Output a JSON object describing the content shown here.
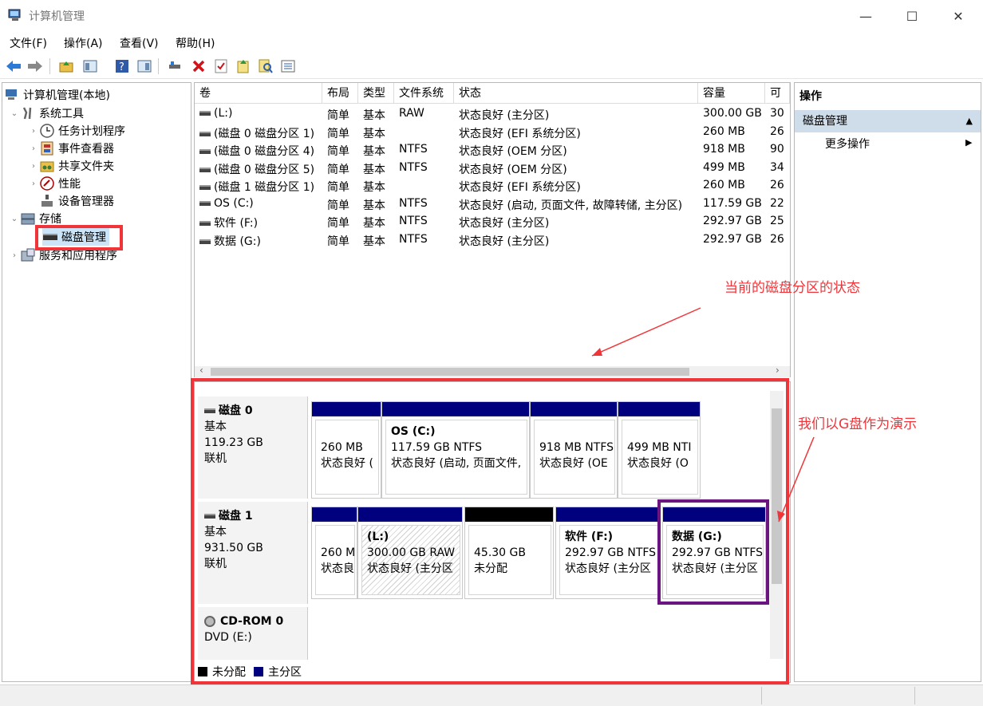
{
  "window": {
    "title": "计算机管理",
    "minimize_glyph": "—",
    "maximize_glyph": "☐",
    "close_glyph": "✕"
  },
  "menu": [
    "文件(F)",
    "操作(A)",
    "查看(V)",
    "帮助(H)"
  ],
  "toolbar_icons": [
    "back-arrow-icon",
    "forward-arrow-icon",
    "up-folder-icon",
    "show-hide-tree-icon",
    "help-icon",
    "properties-view-icon",
    "connect-icon",
    "delete-icon",
    "checklist-icon",
    "export-icon",
    "search-icon",
    "details-icon"
  ],
  "tree": {
    "root": "计算机管理(本地)",
    "system_tools": "系统工具",
    "task_scheduler": "任务计划程序",
    "event_viewer": "事件查看器",
    "shared_folders": "共享文件夹",
    "performance": "性能",
    "device_manager": "设备管理器",
    "storage": "存储",
    "disk_management": "磁盘管理",
    "services_apps": "服务和应用程序"
  },
  "volume_table": {
    "columns": [
      "卷",
      "布局",
      "类型",
      "文件系统",
      "状态",
      "容量",
      "可"
    ],
    "rows": [
      {
        "vol": "(L:)",
        "layout": "简单",
        "type": "基本",
        "fs": "RAW",
        "status": "状态良好 (主分区)",
        "capacity": "300.00 GB",
        "free": "30"
      },
      {
        "vol": "(磁盘 0 磁盘分区 1)",
        "layout": "简单",
        "type": "基本",
        "fs": "",
        "status": "状态良好 (EFI 系统分区)",
        "capacity": "260 MB",
        "free": "26"
      },
      {
        "vol": "(磁盘 0 磁盘分区 4)",
        "layout": "简单",
        "type": "基本",
        "fs": "NTFS",
        "status": "状态良好 (OEM 分区)",
        "capacity": "918 MB",
        "free": "90"
      },
      {
        "vol": "(磁盘 0 磁盘分区 5)",
        "layout": "简单",
        "type": "基本",
        "fs": "NTFS",
        "status": "状态良好 (OEM 分区)",
        "capacity": "499 MB",
        "free": "34"
      },
      {
        "vol": "(磁盘 1 磁盘分区 1)",
        "layout": "简单",
        "type": "基本",
        "fs": "",
        "status": "状态良好 (EFI 系统分区)",
        "capacity": "260 MB",
        "free": "26"
      },
      {
        "vol": "OS (C:)",
        "layout": "简单",
        "type": "基本",
        "fs": "NTFS",
        "status": "状态良好 (启动, 页面文件, 故障转储, 主分区)",
        "capacity": "117.59 GB",
        "free": "22"
      },
      {
        "vol": "软件 (F:)",
        "layout": "简单",
        "type": "基本",
        "fs": "NTFS",
        "status": "状态良好 (主分区)",
        "capacity": "292.97 GB",
        "free": "25"
      },
      {
        "vol": "数据 (G:)",
        "layout": "简单",
        "type": "基本",
        "fs": "NTFS",
        "status": "状态良好 (主分区)",
        "capacity": "292.97 GB",
        "free": "26"
      }
    ]
  },
  "disks": {
    "disk0": {
      "name": "磁盘 0",
      "type": "基本",
      "size": "119.23 GB",
      "state": "联机",
      "parts": [
        {
          "name": "",
          "l1": "260 MB",
          "l2": "状态良好 ("
        },
        {
          "name": "OS  (C:)",
          "l1": "117.59 GB NTFS",
          "l2": "状态良好 (启动, 页面文件,"
        },
        {
          "name": "",
          "l1": "918 MB NTFS",
          "l2": "状态良好 (OE"
        },
        {
          "name": "",
          "l1": "499 MB NTI",
          "l2": "状态良好 (O"
        }
      ]
    },
    "disk1": {
      "name": "磁盘 1",
      "type": "基本",
      "size": "931.50 GB",
      "state": "联机",
      "parts": [
        {
          "name": "",
          "l1": "260 M",
          "l2": "状态良"
        },
        {
          "name": "(L:)",
          "l1": "300.00 GB RAW",
          "l2": "状态良好 (主分区"
        },
        {
          "name": "",
          "l1": "45.30 GB",
          "l2": "未分配"
        },
        {
          "name": "软件  (F:)",
          "l1": "292.97 GB NTFS",
          "l2": "状态良好 (主分区"
        },
        {
          "name": "数据  (G:)",
          "l1": "292.97 GB NTFS",
          "l2": "状态良好 (主分区"
        }
      ]
    },
    "cdrom": {
      "name": "CD-ROM 0",
      "type": "DVD (E:)"
    }
  },
  "legend": {
    "unallocated": "未分配",
    "primary": "主分区"
  },
  "actions": {
    "header": "操作",
    "section": "磁盘管理",
    "more": "更多操作"
  },
  "annotations": {
    "status_note": "当前的磁盘分区的状态",
    "demo_note": "我们以G盘作为演示"
  },
  "colors": {
    "primary_partition": "#00007f",
    "unallocated": "#000000",
    "annotation_red": "#f0353a",
    "highlight_purple": "#6a1580",
    "selected_section": "#cfdce9"
  }
}
